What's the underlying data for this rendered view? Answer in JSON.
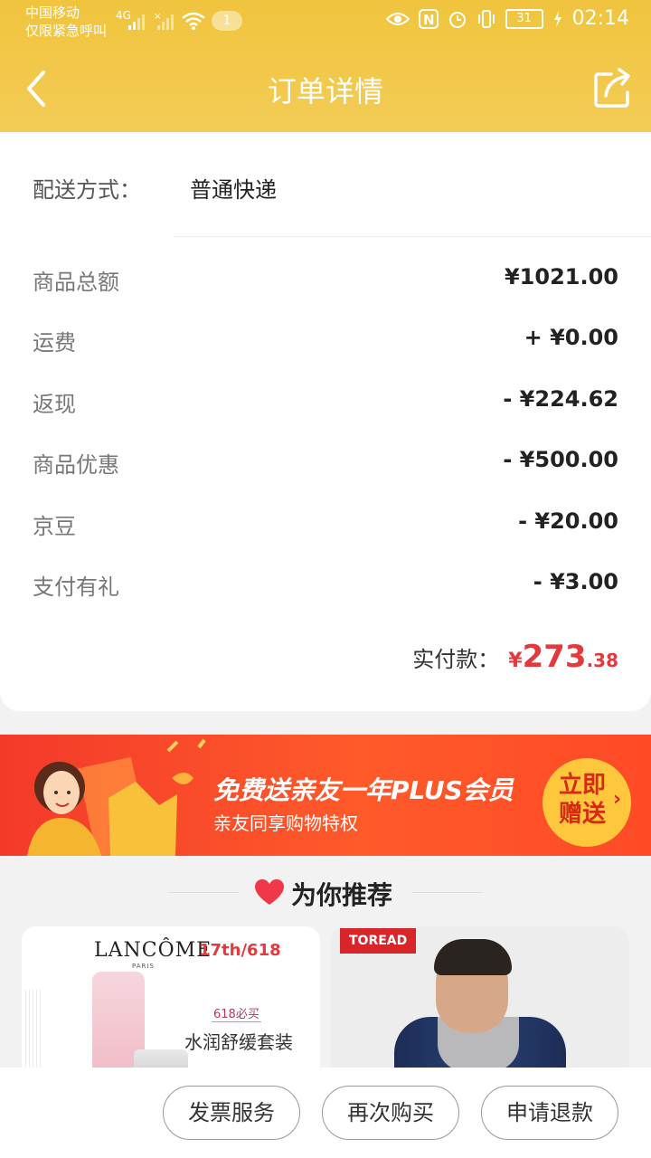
{
  "status_bar": {
    "carrier": "中国移动",
    "carrier_sub": "仅限紧急呼叫",
    "network": "4G",
    "notification_count": "1",
    "battery": "31",
    "time": "02:14"
  },
  "header": {
    "title": "订单详情"
  },
  "delivery": {
    "label": "配送方式：",
    "value": "普通快递"
  },
  "price_rows": [
    {
      "label": "商品总额",
      "value": "¥1021.00"
    },
    {
      "label": "运费",
      "value": "+ ¥0.00"
    },
    {
      "label": "返现",
      "value": "- ¥224.62"
    },
    {
      "label": "商品优惠",
      "value": "- ¥500.00"
    },
    {
      "label": "京豆",
      "value": "- ¥20.00"
    },
    {
      "label": "支付有礼",
      "value": "- ¥3.00"
    }
  ],
  "total": {
    "label": "实付款：",
    "currency": "¥",
    "integer": "273",
    "decimal": ".38"
  },
  "banner": {
    "title": "免费送亲友一年PLUS会员",
    "subtitle": "亲友同享购物特权",
    "button": "立即赠送",
    "button_arrow": "›"
  },
  "recommend": {
    "title": "为你推荐"
  },
  "products": [
    {
      "brand": "LANCÔME",
      "brand_paris": "PARIS",
      "brand_sub": "17th/618",
      "promo_tag": "618必买",
      "promo_text": "水润舒缓套装"
    },
    {
      "brand": "TOREAD"
    }
  ],
  "actions": {
    "invoice": "发票服务",
    "rebuy": "再次购买",
    "refund": "申请退款"
  },
  "colors": {
    "header": "#f0c43d",
    "price_red": "#e4393c",
    "banner": "#f33a2a",
    "banner_button": "#ffc83c"
  }
}
